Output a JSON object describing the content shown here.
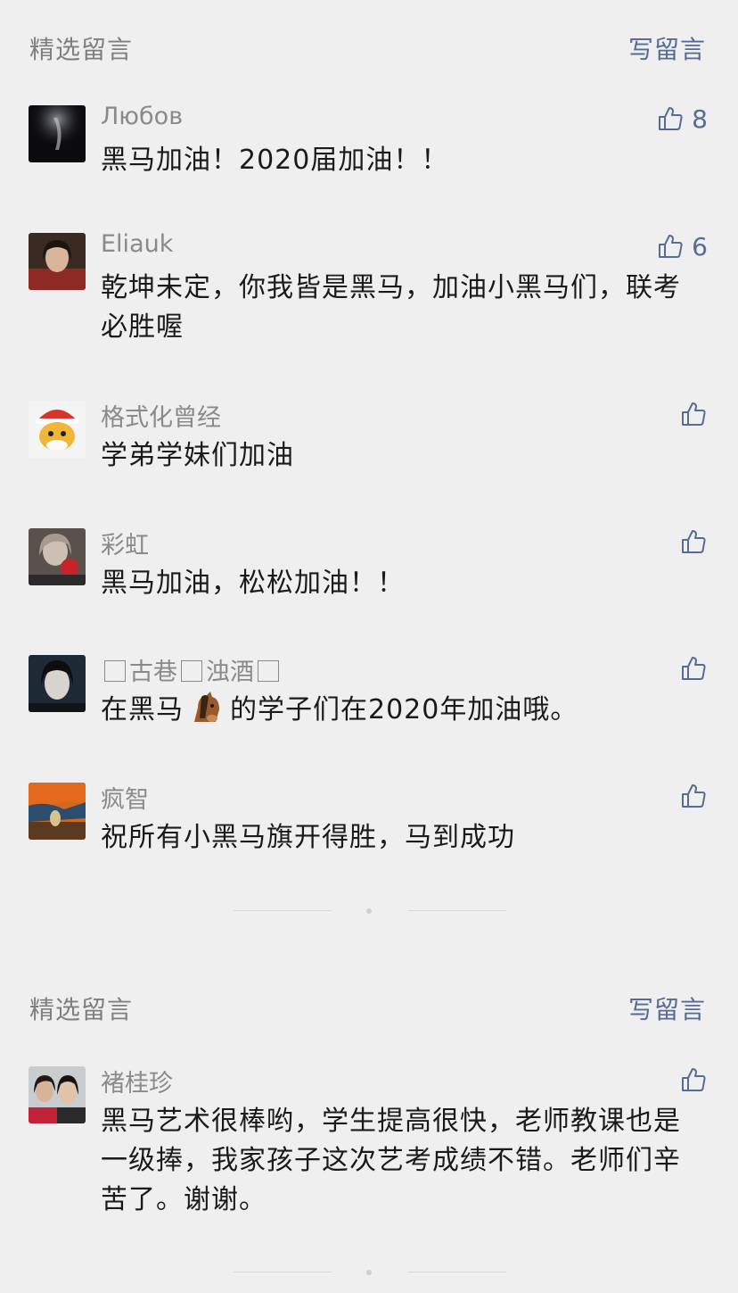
{
  "section1": {
    "title": "精选留言",
    "write": "写留言"
  },
  "comments": [
    {
      "nick": "Любов",
      "text": "黑马加油！2020届加油！！",
      "likes": "8"
    },
    {
      "nick": "Eliauk",
      "text": "乾坤未定，你我皆是黑马，加油小黑马们，联考必胜喔",
      "likes": "6"
    },
    {
      "nick": "格式化曾经",
      "text": "学弟学妹们加油",
      "likes": ""
    },
    {
      "nick": "彩虹",
      "text": "黑马加油，松松加油！！",
      "likes": ""
    },
    {
      "nick_parts": [
        "古巷",
        "浊酒"
      ],
      "text_before": "在黑马",
      "emoji": "horse-face",
      "text_after": "的学子们在2020年加油哦。",
      "likes": ""
    },
    {
      "nick": "疯智",
      "text": "祝所有小黑马旗开得胜，马到成功",
      "likes": ""
    }
  ],
  "section2": {
    "title": "精选留言",
    "write": "写留言"
  },
  "comments2": [
    {
      "nick": "褚桂珍",
      "text": "黑马艺术很棒哟，学生提高很快，老师教课也是一级捧，我家孩子这次艺考成绩不错。老师们辛苦了。谢谢。",
      "likes": ""
    }
  ],
  "icons": {
    "like": "thumbs-up-icon"
  },
  "colors": {
    "link": "#576b95",
    "background": "#efefef",
    "nick": "#8a8a8a",
    "text": "#1a1a1a"
  }
}
